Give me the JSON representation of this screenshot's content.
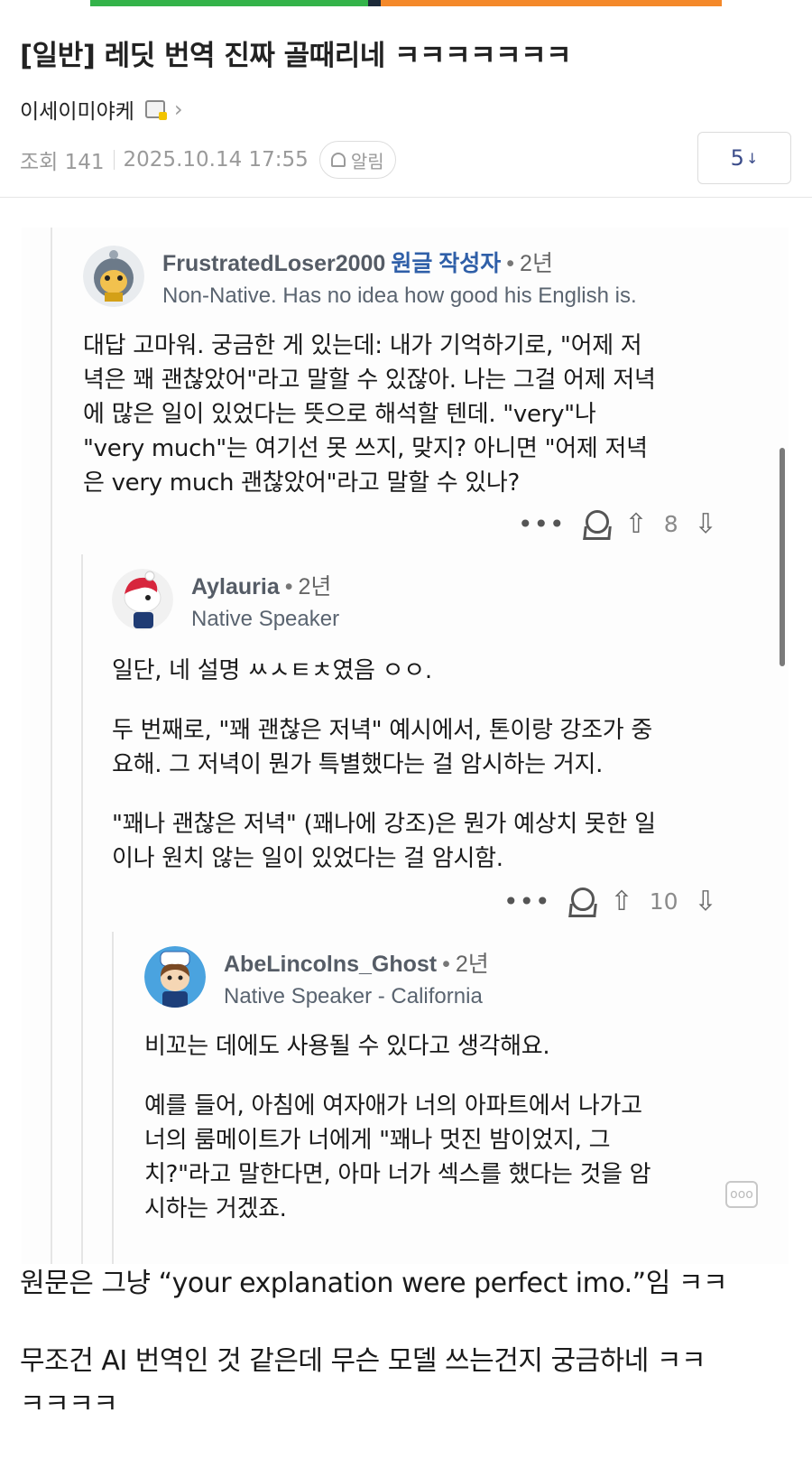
{
  "post": {
    "title": "[일반] 레딧 번역 진짜 골때리네 ㅋㅋㅋㅋㅋㅋㅋ",
    "author": "이세이미야케",
    "views_label": "조회 141",
    "datetime": "2025.10.14 17:55",
    "alarm_label": "알림",
    "comment_count": "5",
    "comment_arrow": "↓"
  },
  "screenshot": {
    "comments": [
      {
        "username": "FrustratedLoser2000",
        "op_tag": "원글 작성자",
        "separator": "•",
        "age": "2년",
        "flair": "Non-Native. Has no idea how good his English is.",
        "paragraphs": [
          "대답 고마워. 궁금한 게 있는데: 내가 기억하기로, \"어제 저",
          "녁은 꽤 괜찮았어\"라고 말할 수 있잖아. 나는 그걸 어제 저녁",
          "에 많은 일이 있었다는 뜻으로 해석할 텐데. \"very\"나",
          "\"very much\"는 여기선 못 쓰지, 맞지? 아니면 \"어제 저녁",
          "은 very much 괜찮았어\"라고 말할 수 있나?"
        ],
        "more": "•••",
        "score": "8",
        "avatar_icon": "fox-astronaut-avatar"
      },
      {
        "username": "Aylauria",
        "separator": "•",
        "age": "2년",
        "flair": "Native Speaker",
        "paragraphs": [
          "일단, 네 설명 ㅆㅅㅌㅊ였음 ㅇㅇ.",
          "두 번째로, \"꽤 괜찮은 저녁\" 예시에서, 톤이랑 강조가 중|요해. 그 저녁이 뭔가 특별했다는 걸 암시하는 거지.",
          "\"꽤나 괜찮은 저녁\" (꽤나에 강조)은 뭔가 예상치 못한 일|이나 원치 않는 일이 있었다는 걸 암시함."
        ],
        "more": "•••",
        "score": "10",
        "avatar_icon": "red-hair-snoo-avatar"
      },
      {
        "username": "AbeLincolns_Ghost",
        "separator": "•",
        "age": "2년",
        "flair": "Native Speaker - California",
        "paragraphs": [
          "비꼬는 데에도 사용될 수 있다고 생각해요.",
          "예를 들어, 아침에 여자애가 너의 아파트에서 나가고|너의 룸메이트가 너에게 \"꽤나 멋진 밤이었지, 그|치?\"라고 말한다면, 아마 너가 섹스를 했다는 것을 암|시하는 거겠죠."
        ],
        "avatar_icon": "hat-snoo-avatar"
      }
    ],
    "chat_icon_glyph": "ooo"
  },
  "body_text": {
    "line1": "원문은 그냥 “your explanation were perfect imo.”임 ㅋㅋ",
    "line2": "무조건 AI 번역인 것 같은데 무슨 모델 쓰는건지 궁금하네 ㅋㅋ",
    "line3": "ㅋㅋㅋㅋ"
  },
  "colors": {
    "username": "#555c66",
    "op_tag": "#2f5fa8",
    "comment_count": "#3b4c8a"
  }
}
